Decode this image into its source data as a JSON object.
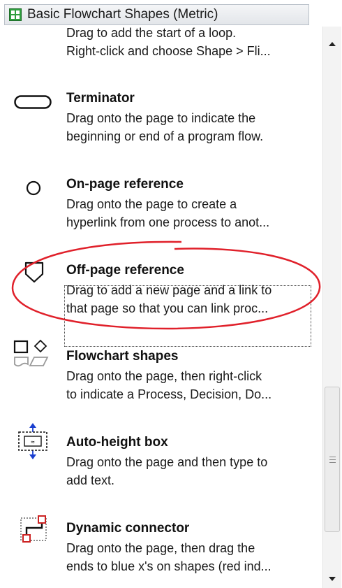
{
  "window": {
    "title": "Basic Flowchart Shapes (Metric)"
  },
  "items": [
    {
      "name": "",
      "desc_line1": "Drag to add the start of a loop.",
      "desc_line2": "Right-click and choose Shape > Fli..."
    },
    {
      "name": "Terminator",
      "desc_line1": "Drag onto the page to indicate the",
      "desc_line2": "beginning or end of a program flow."
    },
    {
      "name": "On-page reference",
      "desc_line1": "Drag onto the page to create a",
      "desc_line2": "hyperlink from one process to anot..."
    },
    {
      "name": "Off-page reference",
      "desc_line1": "Drag to add a new page and a link to",
      "desc_line2": "that page so that you can link proc..."
    },
    {
      "name": "Flowchart shapes",
      "desc_line1": "Drag onto the page, then right-click",
      "desc_line2": "to indicate a Process, Decision, Do..."
    },
    {
      "name": "Auto-height box",
      "desc_line1": "Drag onto the page and then type to",
      "desc_line2": "add text."
    },
    {
      "name": "Dynamic connector",
      "desc_line1": "Drag onto the page, then drag the",
      "desc_line2": "ends to blue x's on shapes (red ind..."
    }
  ],
  "selected_item": "Off-page reference",
  "colors": {
    "annotation_red": "#e0202a",
    "connector_blue": "#1a3fd0",
    "connector_red": "#cc2222",
    "stencil_green": "#2e9e3e"
  },
  "icons": {
    "stencil": "green-stencil-grid-icon",
    "loop": "loop-limit-icon",
    "terminator": "terminator-icon",
    "on_page": "on-page-reference-icon",
    "off_page": "off-page-reference-icon",
    "flowchart": "flowchart-shapes-icon",
    "auto_height": "auto-height-box-icon",
    "connector": "dynamic-connector-icon"
  }
}
